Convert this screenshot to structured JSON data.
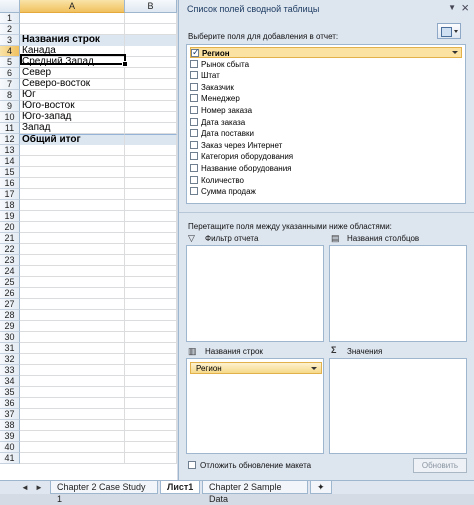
{
  "sheet": {
    "columns": [
      "A",
      "B"
    ],
    "rows": [
      {
        "num": "1",
        "a": ""
      },
      {
        "num": "2",
        "a": ""
      },
      {
        "num": "3",
        "a": "Названия строк",
        "type": "header"
      },
      {
        "num": "4",
        "a": "Канада",
        "type": "active"
      },
      {
        "num": "5",
        "a": "Средний Запад"
      },
      {
        "num": "6",
        "a": "Север"
      },
      {
        "num": "7",
        "a": "Северо-восток"
      },
      {
        "num": "8",
        "a": "Юг"
      },
      {
        "num": "9",
        "a": "Юго-восток"
      },
      {
        "num": "10",
        "a": "Юго-запад"
      },
      {
        "num": "11",
        "a": "Запад"
      },
      {
        "num": "12",
        "a": "Общий итог",
        "type": "total"
      },
      {
        "num": "13",
        "a": ""
      },
      {
        "num": "14",
        "a": ""
      },
      {
        "num": "15",
        "a": ""
      },
      {
        "num": "16",
        "a": ""
      },
      {
        "num": "17",
        "a": ""
      },
      {
        "num": "18",
        "a": ""
      },
      {
        "num": "19",
        "a": ""
      },
      {
        "num": "20",
        "a": ""
      },
      {
        "num": "21",
        "a": ""
      },
      {
        "num": "22",
        "a": ""
      },
      {
        "num": "23",
        "a": ""
      },
      {
        "num": "24",
        "a": ""
      },
      {
        "num": "25",
        "a": ""
      },
      {
        "num": "26",
        "a": ""
      },
      {
        "num": "27",
        "a": ""
      },
      {
        "num": "28",
        "a": ""
      },
      {
        "num": "29",
        "a": ""
      },
      {
        "num": "30",
        "a": ""
      },
      {
        "num": "31",
        "a": ""
      },
      {
        "num": "32",
        "a": ""
      },
      {
        "num": "33",
        "a": ""
      },
      {
        "num": "34",
        "a": ""
      },
      {
        "num": "35",
        "a": ""
      },
      {
        "num": "36",
        "a": ""
      },
      {
        "num": "37",
        "a": ""
      },
      {
        "num": "38",
        "a": ""
      },
      {
        "num": "39",
        "a": ""
      },
      {
        "num": "40",
        "a": ""
      },
      {
        "num": "41",
        "a": ""
      }
    ]
  },
  "tabs": {
    "nav": [
      "◄",
      "►"
    ],
    "items": [
      {
        "label": "Chapter 2 Case Study 1",
        "active": false
      },
      {
        "label": "Лист1",
        "active": true
      },
      {
        "label": "Chapter 2 Sample Data",
        "active": false
      }
    ]
  },
  "pane": {
    "title": "Список полей сводной таблицы",
    "choose_label": "Выберите поля для добавления в отчет:",
    "fields": [
      {
        "label": "Регион",
        "checked": true,
        "selected": true
      },
      {
        "label": "Рынок сбыта",
        "checked": false
      },
      {
        "label": "Штат",
        "checked": false
      },
      {
        "label": "Заказчик",
        "checked": false
      },
      {
        "label": "Менеджер",
        "checked": false
      },
      {
        "label": "Номер заказа",
        "checked": false
      },
      {
        "label": "Дата заказа",
        "checked": false
      },
      {
        "label": "Дата поставки",
        "checked": false
      },
      {
        "label": "Заказ через Интернет",
        "checked": false
      },
      {
        "label": "Категория оборудования",
        "checked": false
      },
      {
        "label": "Название оборудования",
        "checked": false
      },
      {
        "label": "Количество",
        "checked": false
      },
      {
        "label": "Сумма продаж",
        "checked": false
      }
    ],
    "drag_label": "Перетащите поля между указанными ниже областями:",
    "zones": {
      "filter": {
        "title": "Фильтр отчета",
        "icon": "filter-icon"
      },
      "columns": {
        "title": "Названия столбцов",
        "icon": "columns-icon"
      },
      "rows": {
        "title": "Названия строк",
        "icon": "rows-icon",
        "chip": "Регион"
      },
      "values": {
        "title": "Значения",
        "icon": "sigma-icon"
      }
    },
    "defer_label": "Отложить обновление макета",
    "update_label": "Обновить"
  }
}
